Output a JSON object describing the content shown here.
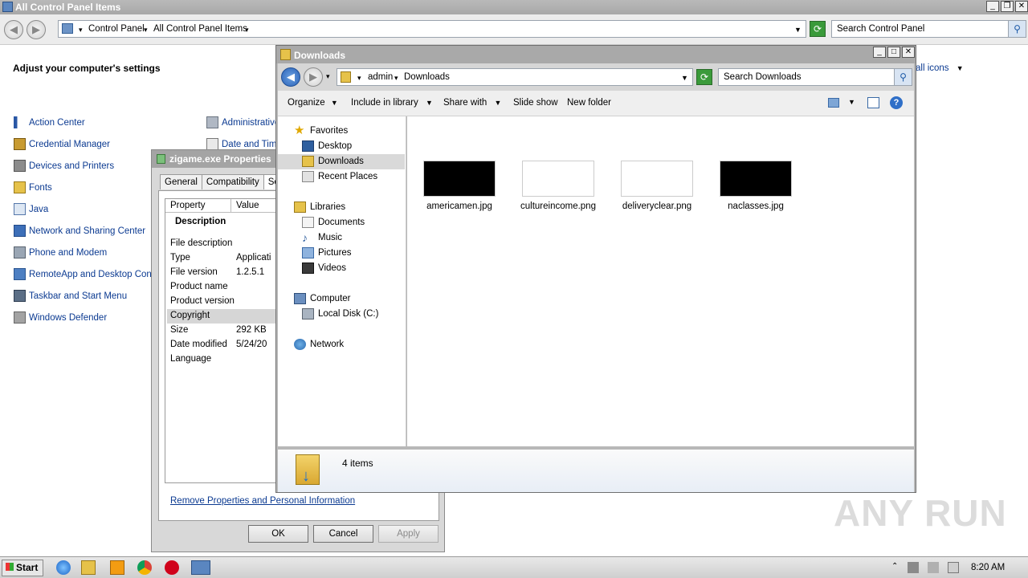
{
  "control_panel": {
    "title": "All Control Panel Items",
    "breadcrumb": [
      "Control Panel",
      "All Control Panel Items"
    ],
    "search_placeholder": "Search Control Panel",
    "heading": "Adjust your computer's settings",
    "view_by": "all icons",
    "items_left": [
      "Action Center",
      "Credential Manager",
      "Devices and Printers",
      "Fonts",
      "Java",
      "Network and Sharing Center",
      "Phone and Modem",
      "RemoteApp and Desktop Conne",
      "Taskbar and Start Menu",
      "Windows Defender"
    ],
    "items_right": [
      "Administrative",
      "Date and Time"
    ]
  },
  "properties": {
    "title": "zigame.exe Properties",
    "tabs": [
      "General",
      "Compatibility",
      "Sec"
    ],
    "col_property": "Property",
    "col_value": "Value",
    "section": "Description",
    "rows": [
      {
        "name": "File description",
        "value": ""
      },
      {
        "name": "Type",
        "value": "Applicati"
      },
      {
        "name": "File version",
        "value": "1.2.5.1"
      },
      {
        "name": "Product name",
        "value": ""
      },
      {
        "name": "Product version",
        "value": ""
      },
      {
        "name": "Copyright",
        "value": ""
      },
      {
        "name": "Size",
        "value": "292 KB"
      },
      {
        "name": "Date modified",
        "value": "5/24/20"
      },
      {
        "name": "Language",
        "value": ""
      }
    ],
    "remove_link": "Remove Properties and Personal Information",
    "ok": "OK",
    "cancel": "Cancel",
    "apply": "Apply"
  },
  "downloads": {
    "title": "Downloads",
    "breadcrumb": [
      "admin",
      "Downloads"
    ],
    "search_placeholder": "Search Downloads",
    "commands": [
      "Organize",
      "Include in library",
      "Share with",
      "Slide show",
      "New folder"
    ],
    "nav": {
      "favorites": "Favorites",
      "desktop": "Desktop",
      "downloads": "Downloads",
      "recent": "Recent Places",
      "libraries": "Libraries",
      "documents": "Documents",
      "music": "Music",
      "pictures": "Pictures",
      "videos": "Videos",
      "computer": "Computer",
      "local_disk": "Local Disk (C:)",
      "network": "Network"
    },
    "files": [
      {
        "name": "americamen.jpg",
        "thumb": "#000000"
      },
      {
        "name": "cultureincome.png",
        "thumb": "#ffffff"
      },
      {
        "name": "deliveryclear.png",
        "thumb": "#ffffff"
      },
      {
        "name": "naclasses.jpg",
        "thumb": "#000000"
      }
    ],
    "item_count": "4 items"
  },
  "taskbar": {
    "start": "Start",
    "clock": "8:20 AM"
  },
  "watermark": "ANY RUN"
}
